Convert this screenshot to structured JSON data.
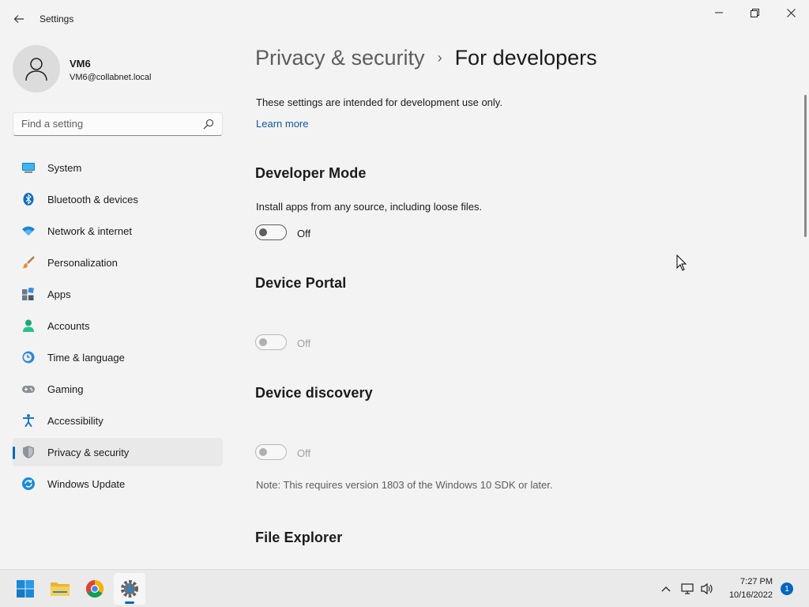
{
  "window": {
    "app_title": "Settings"
  },
  "profile": {
    "name": "VM6",
    "email": "VM6@collabnet.local"
  },
  "search": {
    "placeholder": "Find a setting"
  },
  "sidebar": {
    "items": [
      {
        "label": "System",
        "icon": "system-icon"
      },
      {
        "label": "Bluetooth & devices",
        "icon": "bluetooth-icon"
      },
      {
        "label": "Network & internet",
        "icon": "wifi-icon"
      },
      {
        "label": "Personalization",
        "icon": "brush-icon"
      },
      {
        "label": "Apps",
        "icon": "apps-icon"
      },
      {
        "label": "Accounts",
        "icon": "accounts-icon"
      },
      {
        "label": "Time & language",
        "icon": "clock-globe-icon"
      },
      {
        "label": "Gaming",
        "icon": "gamepad-icon"
      },
      {
        "label": "Accessibility",
        "icon": "accessibility-icon"
      },
      {
        "label": "Privacy & security",
        "icon": "shield-icon",
        "selected": true
      },
      {
        "label": "Windows Update",
        "icon": "update-icon"
      }
    ]
  },
  "breadcrumb": {
    "parent": "Privacy & security",
    "separator": "›",
    "current": "For developers"
  },
  "intro": {
    "text": "These settings are intended for development use only.",
    "link": "Learn more"
  },
  "sections": {
    "developer_mode": {
      "title": "Developer Mode",
      "description": "Install apps from any source, including loose files.",
      "state": "Off"
    },
    "device_portal": {
      "title": "Device Portal",
      "state": "Off"
    },
    "device_discovery": {
      "title": "Device discovery",
      "state": "Off",
      "note": "Note: This requires version 1803 of the Windows 10 SDK or later."
    },
    "file_explorer": {
      "title": "File Explorer"
    }
  },
  "taskbar": {
    "time": "7:27 PM",
    "date": "10/16/2022",
    "notification_count": "1"
  },
  "colors": {
    "accent": "#0067c0",
    "link": "#0f5a9c",
    "background": "#f3f3f3"
  }
}
